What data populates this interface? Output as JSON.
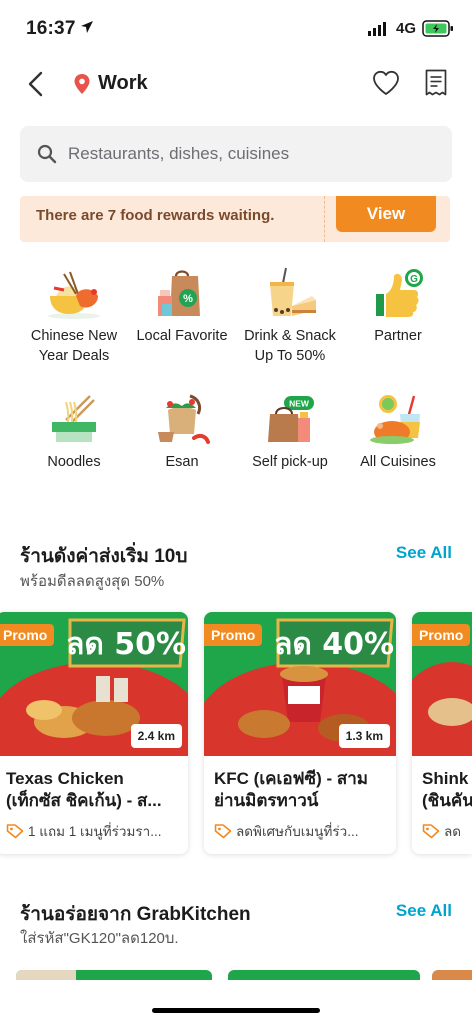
{
  "status_bar": {
    "time": "16:37",
    "network": "4G"
  },
  "header": {
    "location": "Work"
  },
  "search": {
    "placeholder": "Restaurants, dishes, cuisines"
  },
  "rewards": {
    "text": "There are 7 food rewards waiting.",
    "button": "View"
  },
  "categories": [
    {
      "line1": "Chinese New",
      "line2": "Year Deals",
      "icon": "chinese-food-icon"
    },
    {
      "line1": "Local Favorite",
      "line2": "",
      "icon": "shopping-bag-icon"
    },
    {
      "line1": "Drink & Snack",
      "line2": "Up To 50%",
      "icon": "drink-snack-icon"
    },
    {
      "line1": "Partner",
      "line2": "",
      "icon": "thumbs-up-icon"
    },
    {
      "line1": "Noodles",
      "line2": "",
      "icon": "noodles-icon"
    },
    {
      "line1": "Esan",
      "line2": "",
      "icon": "esan-icon"
    },
    {
      "line1": "Self pick-up",
      "line2": "",
      "icon": "pickup-bag-icon",
      "badge": "NEW"
    },
    {
      "line1": "All Cuisines",
      "line2": "",
      "icon": "cuisines-icon"
    }
  ],
  "section1": {
    "title": "ร้านดังค่าส่งเริ่ม 10บ",
    "subtitle": "พร้อมดีลลดสูงสุด 50%",
    "see_all": "See All",
    "cards": [
      {
        "promo": "Promo",
        "banner": "ลด 50%",
        "distance": "2.4 km",
        "name_line1": "Texas Chicken",
        "name_line2": "(เท็กซัส ชิคเก้น) - ส...",
        "offer": "1 แถม 1 เมนูที่ร่วมรา..."
      },
      {
        "promo": "Promo",
        "banner": "ลด 40%",
        "distance": "1.3 km",
        "name_line1": "KFC (เคเอฟซี) - สาม",
        "name_line2": "ย่านมิตรทาวน์",
        "offer": "ลดพิเศษกับเมนูที่ร่ว..."
      },
      {
        "promo": "Promo",
        "banner": "",
        "distance": "",
        "name_line1": "Shink",
        "name_line2": "(ชินคัน",
        "offer": "ลด"
      }
    ]
  },
  "section2": {
    "title": "ร้านอร่อยจาก GrabKitchen",
    "subtitle": "ใส่รหัส\"GK120\"ลด120บ.",
    "see_all": "See All"
  },
  "colors": {
    "accent_orange": "#f08a21",
    "link_blue": "#00a5cf",
    "card_green": "#1fa64a",
    "banner_bg": "#fde9d9"
  }
}
